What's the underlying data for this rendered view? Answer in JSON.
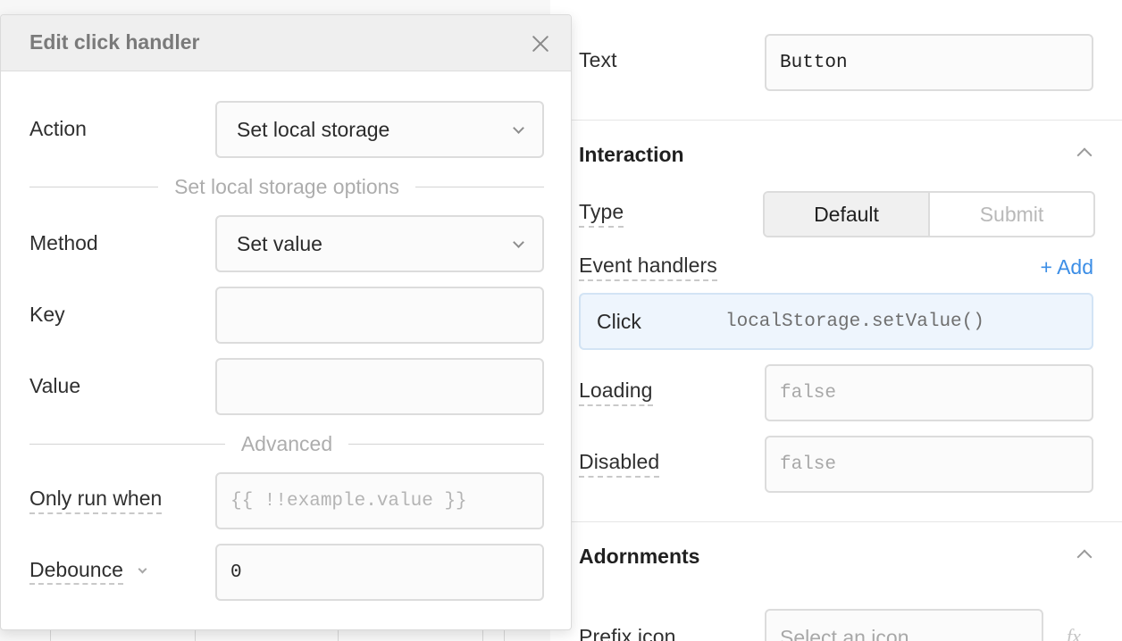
{
  "modal": {
    "title": "Edit click handler",
    "action_label": "Action",
    "action_value": "Set local storage",
    "options_heading": "Set local storage options",
    "method_label": "Method",
    "method_value": "Set value",
    "key_label": "Key",
    "key_value": "",
    "value_label": "Value",
    "value_value": "",
    "advanced_heading": "Advanced",
    "only_run_when_label": "Only run when",
    "only_run_when_placeholder": "{{ !!example.value }}",
    "debounce_label": "Debounce",
    "debounce_value": "0"
  },
  "inspector": {
    "text_label": "Text",
    "text_value": "Button",
    "interaction_title": "Interaction",
    "type_label": "Type",
    "type_options": [
      "Default",
      "Submit"
    ],
    "type_selected": "Default",
    "event_handlers_label": "Event handlers",
    "add_label": "+ Add",
    "handler": {
      "event": "Click",
      "action": "localStorage.setValue()"
    },
    "loading_label": "Loading",
    "loading_value": "false",
    "disabled_label": "Disabled",
    "disabled_value": "false",
    "adornments_title": "Adornments",
    "prefix_icon_label": "Prefix icon",
    "prefix_icon_placeholder": "Select an icon",
    "fx_label": "fx"
  },
  "colors": {
    "accent": "#3c8ee6",
    "handler_bg": "#eef5fd",
    "header_bg": "#efefef"
  }
}
